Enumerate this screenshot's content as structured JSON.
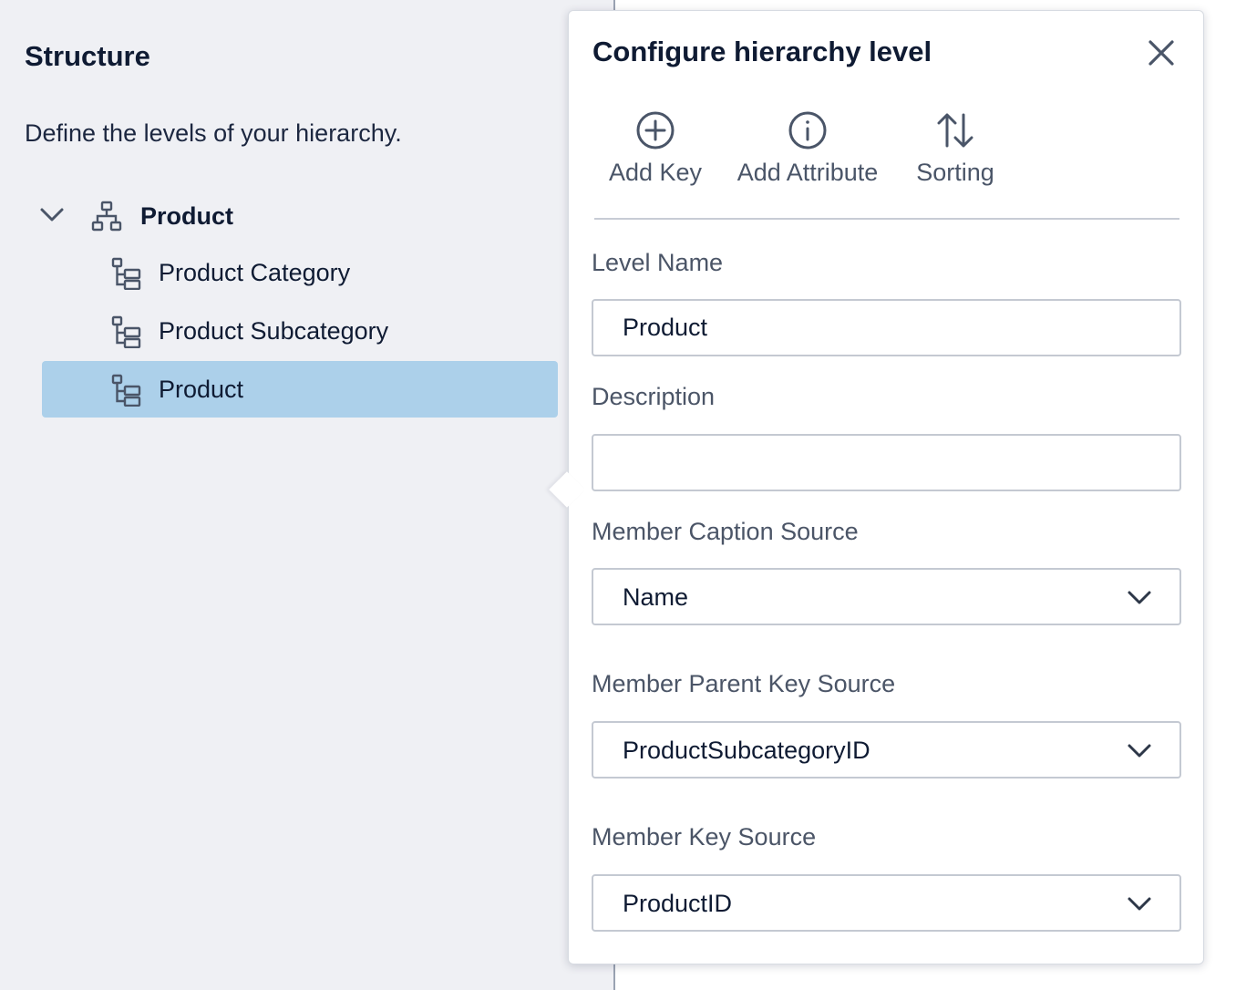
{
  "structure": {
    "title": "Structure",
    "description": "Define the levels of your hierarchy.",
    "root": {
      "label": "Product",
      "expanded": true,
      "icon": "hierarchy-icon"
    },
    "levels": [
      {
        "label": "Product Category",
        "icon": "level-icon",
        "selected": false
      },
      {
        "label": "Product Subcategory",
        "icon": "level-icon",
        "selected": false
      },
      {
        "label": "Product",
        "icon": "level-icon",
        "selected": true
      }
    ]
  },
  "popover": {
    "title": "Configure hierarchy level",
    "close_icon": "close-icon",
    "toolbar": [
      {
        "label": "Add Key",
        "icon": "plus-circle-icon"
      },
      {
        "label": "Add Attribute",
        "icon": "info-circle-icon"
      },
      {
        "label": "Sorting",
        "icon": "sort-arrows-icon"
      }
    ],
    "level_name": {
      "label": "Level Name",
      "value": "Product"
    },
    "description": {
      "label": "Description",
      "value": ""
    },
    "member_caption_source": {
      "label": "Member Caption Source",
      "value": "Name"
    },
    "member_parent_key_source": {
      "label": "Member Parent Key Source",
      "value": "ProductSubcategoryID"
    },
    "member_key_source": {
      "label": "Member Key Source",
      "value": "ProductID"
    }
  },
  "colors": {
    "background": "#eff0f4",
    "selected_row": "#acd0ea",
    "text_primary": "#0f1b33",
    "text_secondary": "#4b5567",
    "input_border": "#c4c9d2"
  }
}
